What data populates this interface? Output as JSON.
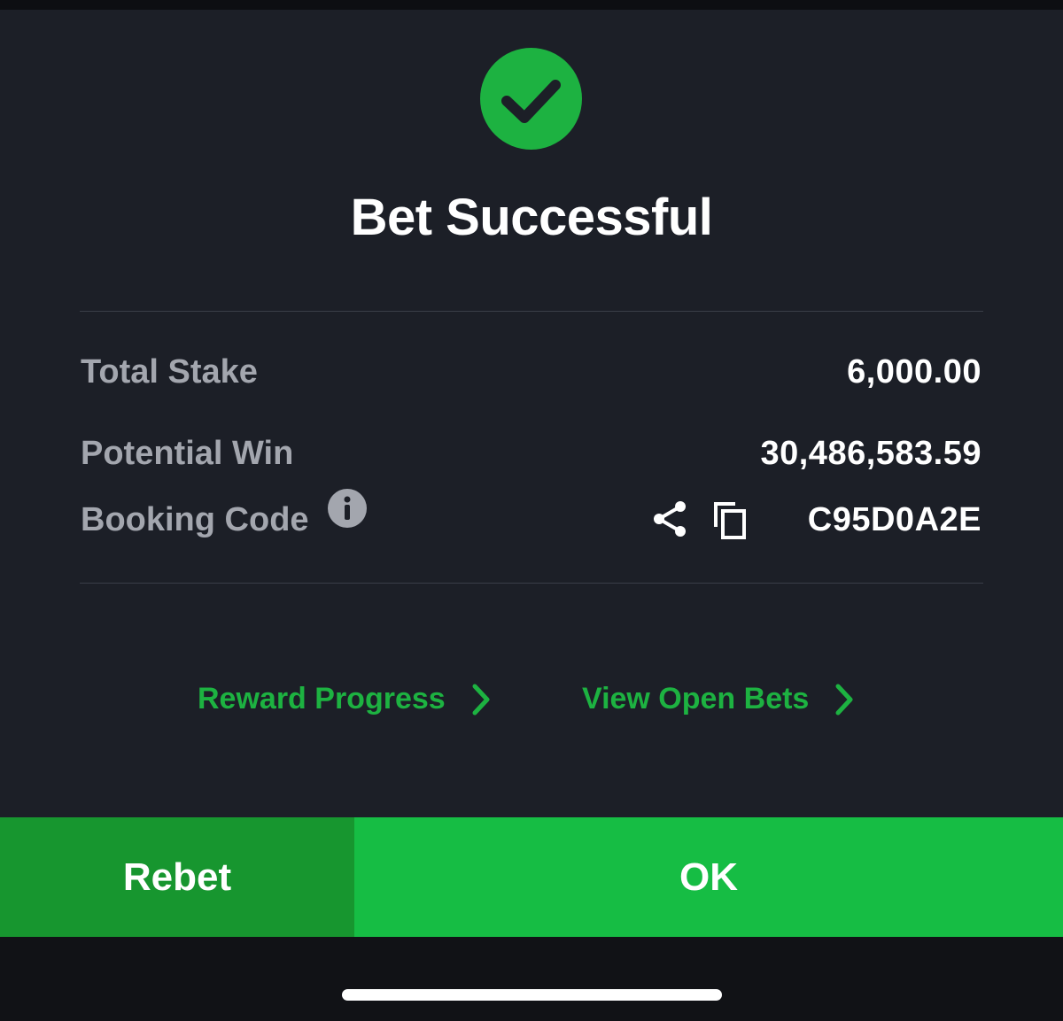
{
  "dialog": {
    "title": "Bet Successful",
    "success_icon": "check-circle-icon"
  },
  "details": {
    "total_stake_label": "Total Stake",
    "total_stake_value": "6,000.00",
    "potential_win_label": "Potential Win",
    "potential_win_value": "30,486,583.59",
    "booking_code_label": "Booking Code",
    "booking_code_value": "C95D0A2E",
    "icons": [
      "info-icon",
      "share-icon",
      "copy-icon"
    ]
  },
  "links": {
    "reward_progress": "Reward Progress",
    "view_open_bets": "View Open Bets"
  },
  "actions": {
    "rebet": "Rebet",
    "ok": "OK"
  },
  "colors": {
    "accent_green": "#1db241",
    "ok_green": "#16bd44",
    "rebet_green": "#17962f",
    "sheet_bg": "#1c1f27"
  }
}
